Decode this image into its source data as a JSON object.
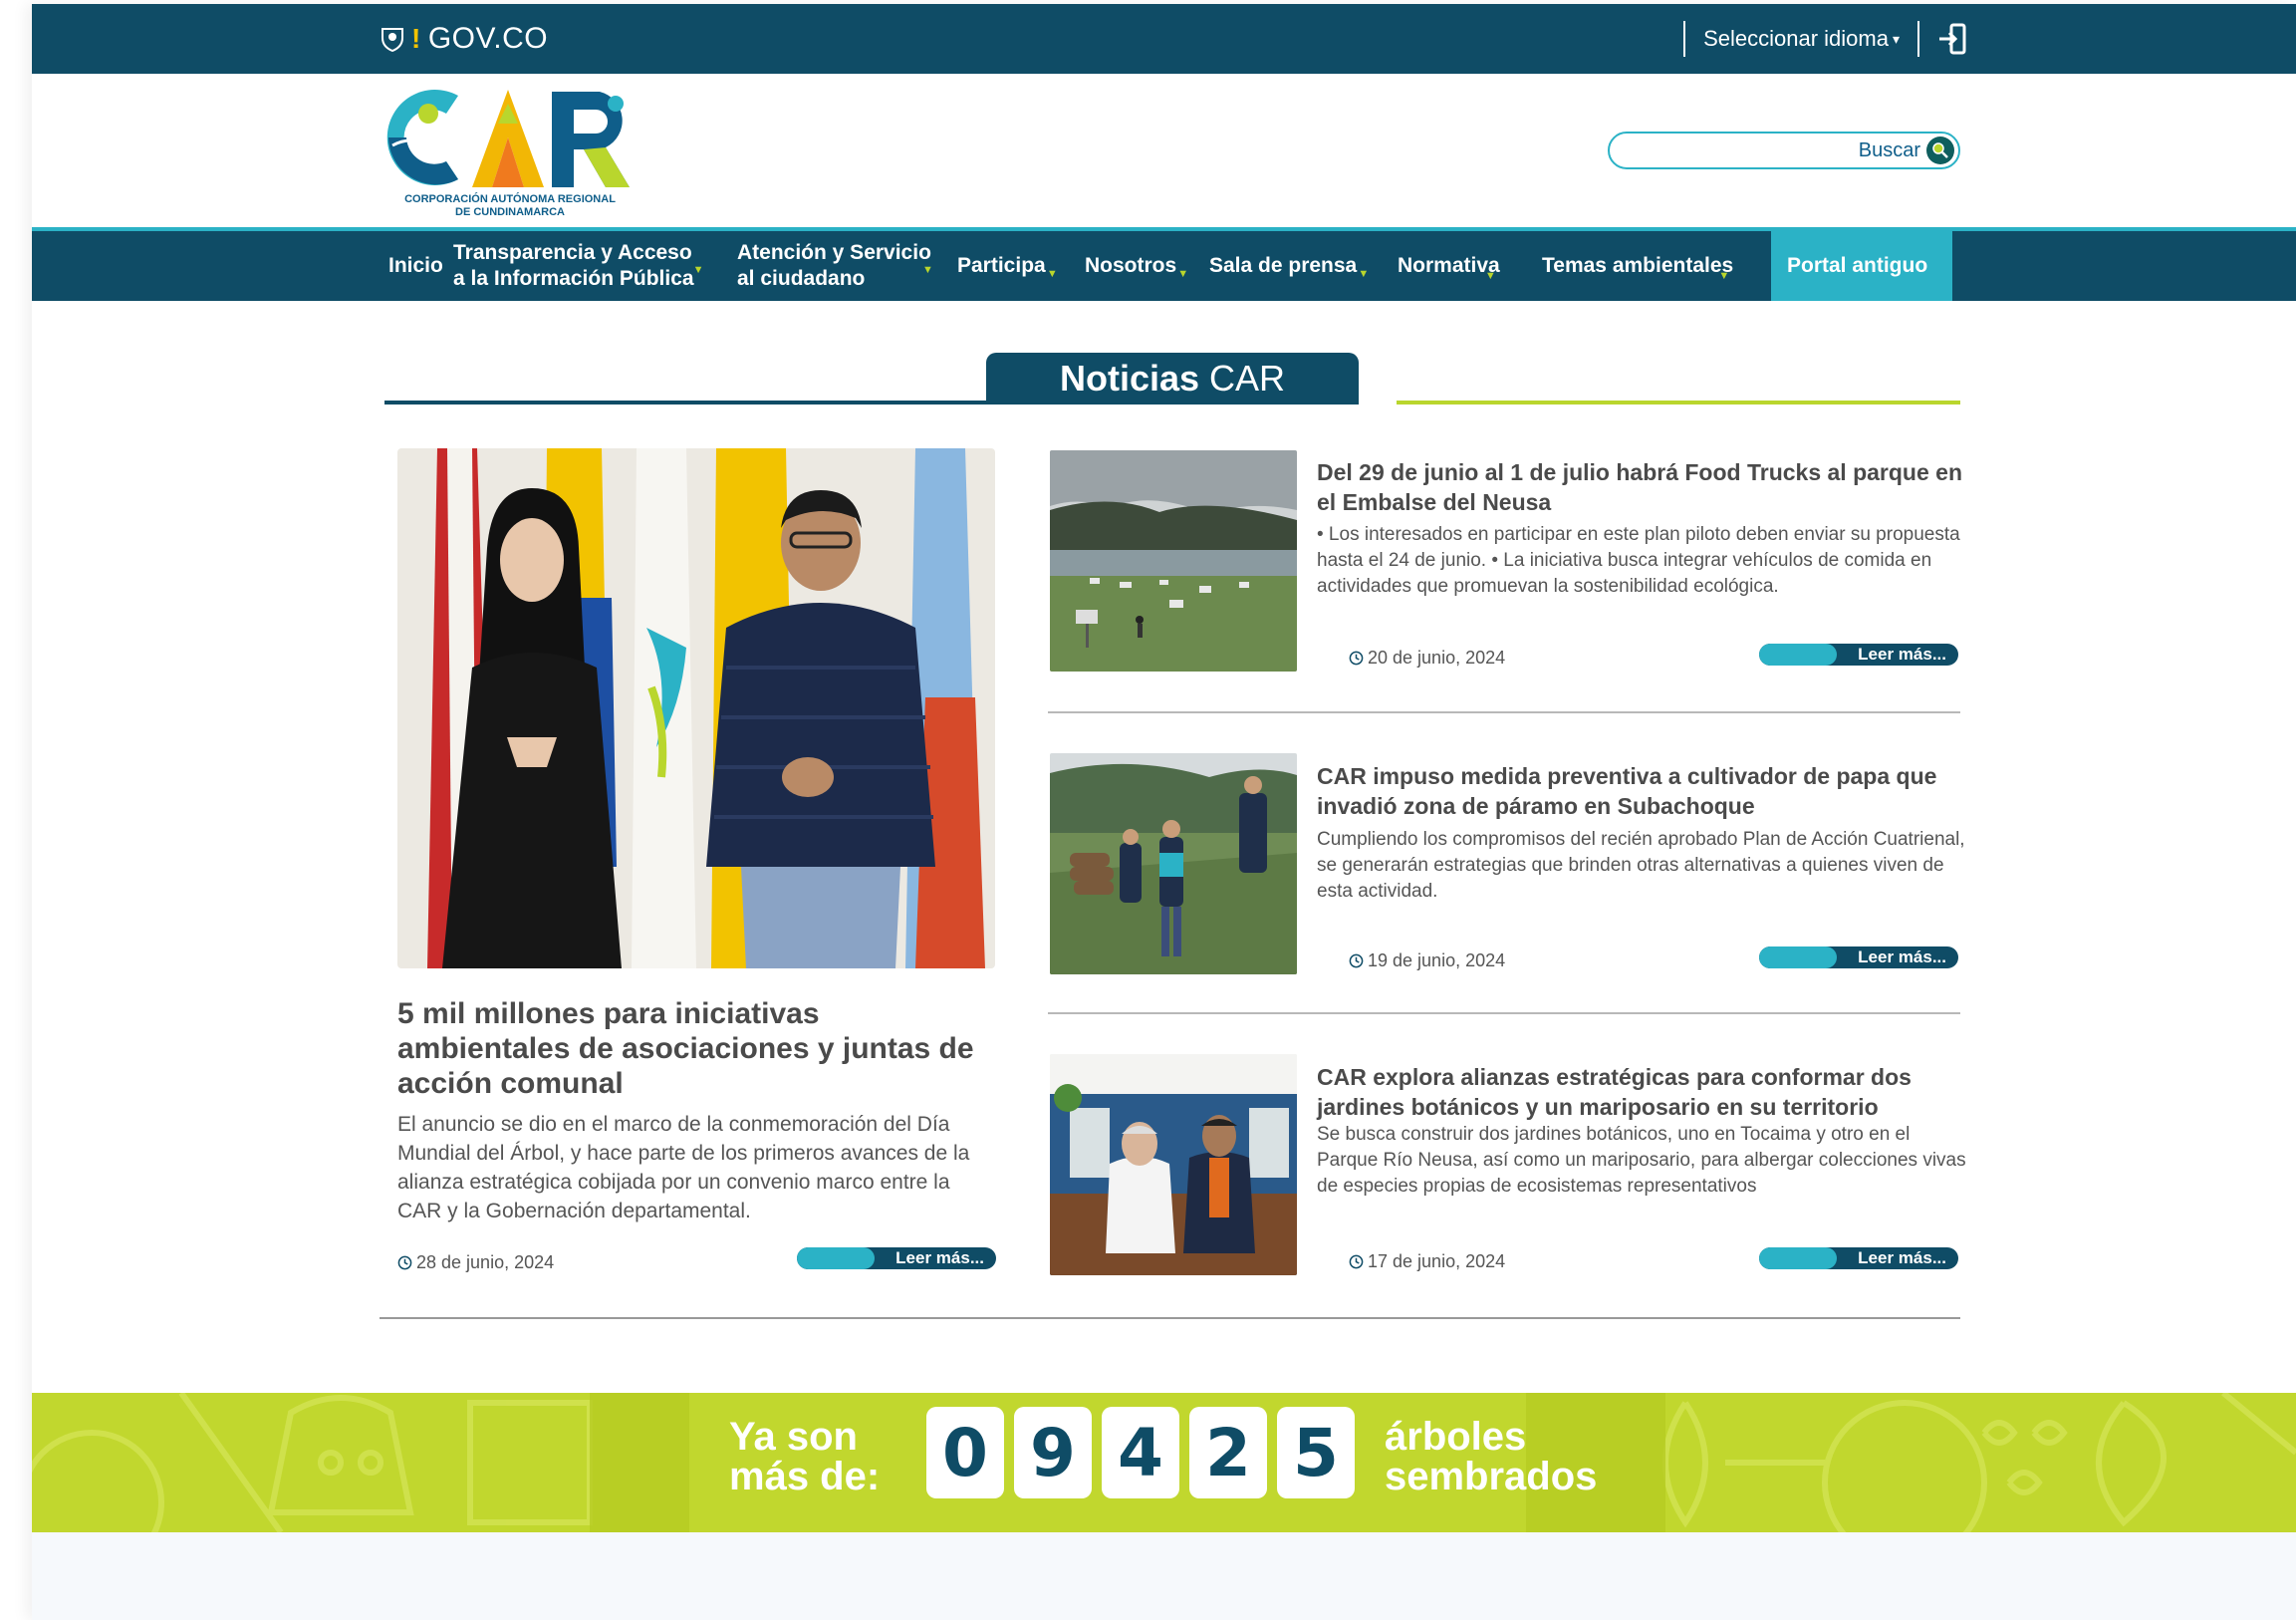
{
  "gov_bar": {
    "logo_text": "GOV.CO",
    "language_label": "Seleccionar idioma",
    "login_icon": "login-icon"
  },
  "header": {
    "logo_line1": "CORPORACIÓN AUTÓNOMA REGIONAL",
    "logo_line2": "DE CUNDINAMARCA",
    "search_label": "Buscar"
  },
  "nav": {
    "items": [
      {
        "line1": "Inicio",
        "line2": ""
      },
      {
        "line1": "Transparencia y Acceso",
        "line2": "a la Información Pública"
      },
      {
        "line1": "Atención y Servicio",
        "line2": "al ciudadano"
      },
      {
        "line1": "Participa",
        "line2": ""
      },
      {
        "line1": "Nosotros",
        "line2": ""
      },
      {
        "line1": "Sala de prensa",
        "line2": ""
      },
      {
        "line1": "Normativa",
        "line2": ""
      },
      {
        "line1": "Temas ambientales",
        "line2": ""
      },
      {
        "line1": "Portal antiguo",
        "line2": ""
      }
    ]
  },
  "news": {
    "section_bold": "Noticias",
    "section_light": "CAR",
    "read_more": "Leer más...",
    "featured": {
      "title": "5 mil millones para iniciativas ambientales de asociaciones y juntas de acción comunal",
      "text": "El anuncio se dio en el marco de la conmemoración del Día Mundial del Árbol, y hace parte de los primeros avances de la alianza estratégica cobijada por un convenio marco entre la CAR y la Gobernación departamental.",
      "date": "28 de junio, 2024"
    },
    "side": [
      {
        "title": "Del 29 de junio al 1 de julio habrá Food Trucks al parque en el Embalse del Neusa",
        "text": "• Los interesados en participar en este plan piloto deben enviar su propuesta hasta el 24 de junio. • La iniciativa busca integrar vehículos de comida en actividades que promuevan la sostenibilidad ecológica.",
        "date": "20 de junio, 2024"
      },
      {
        "title": "CAR impuso medida preventiva a cultivador de papa que invadió zona de páramo en Subachoque",
        "text": "Cumpliendo los compromisos del recién aprobado Plan de Acción Cuatrienal, se generarán estrategias que brinden otras alternativas a quienes viven de esta actividad.",
        "date": "19 de junio, 2024"
      },
      {
        "title": "CAR explora alianzas estratégicas para conformar dos jardines botánicos y un mariposario en su territorio",
        "text": "Se busca construir dos jardines botánicos, uno en Tocaima y otro en el Parque Río Neusa, así como un mariposario, para albergar colecciones vivas de especies propias de ecosistemas representativos",
        "date": "17 de junio, 2024"
      }
    ]
  },
  "counter": {
    "left_line1": "Ya son",
    "left_line2": "más de:",
    "digits": [
      "0",
      "9",
      "4",
      "2",
      "5"
    ],
    "right_line1": "árboles",
    "right_line2": "sembrados"
  },
  "colors": {
    "primary": "#0f4c66",
    "accent": "#2bb2c6",
    "lime": "#c1d72e"
  }
}
